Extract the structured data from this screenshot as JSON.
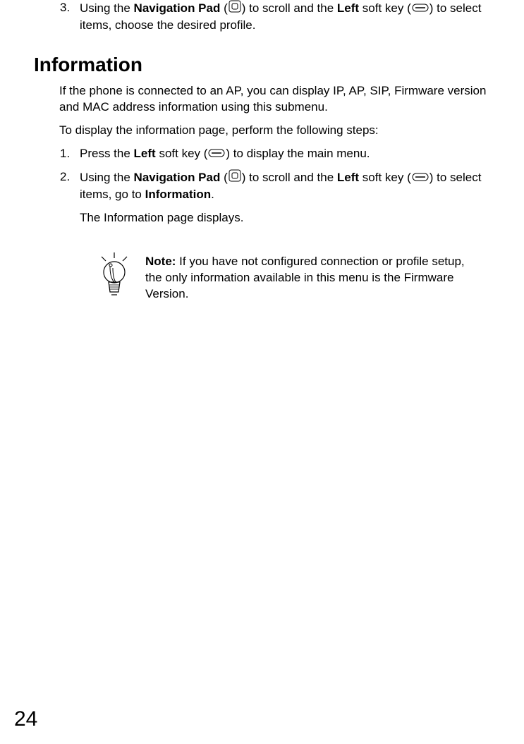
{
  "step3": {
    "num": "3.",
    "t1": "Using the ",
    "navpad": "Navigation Pad",
    "t2": " (",
    "t3": ") to scroll and the ",
    "left": "Left",
    "t4": " soft key (",
    "t5": ") to select items, choose the desired profile."
  },
  "heading": "Information",
  "intro1": "If the phone is connected to an AP, you can display IP, AP, SIP, Firmware version and MAC address information using this submenu.",
  "intro2": "To display the information page, perform the following steps:",
  "step1": {
    "num": "1.",
    "t1": "Press the ",
    "left": "Left",
    "t2": " soft key (",
    "t3": ") to display the main menu."
  },
  "step2": {
    "num": "2.",
    "t1": "Using the ",
    "navpad": "Navigation Pad",
    "t2": " (",
    "t3": ") to scroll and the ",
    "left": "Left",
    "t4": " soft key (",
    "t5": ") to select items, go to ",
    "info": "Information",
    "t6": "."
  },
  "result": "The Information page displays.",
  "note": {
    "label": "Note:",
    "text": " If you have not configured connection or profile setup, the only information available in this menu is the Firmware Version."
  },
  "pageNumber": "24"
}
